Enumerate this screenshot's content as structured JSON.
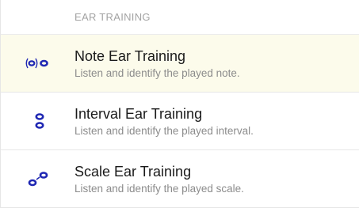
{
  "section": {
    "header": "EAR TRAINING"
  },
  "items": [
    {
      "title": "Note Ear Training",
      "subtitle": "Listen and identify the played note.",
      "icon": "note-icon",
      "selected": true
    },
    {
      "title": "Interval Ear Training",
      "subtitle": "Listen and identify the played interval.",
      "icon": "interval-icon",
      "selected": false
    },
    {
      "title": "Scale Ear Training",
      "subtitle": "Listen and identify the played scale.",
      "icon": "scale-icon",
      "selected": false
    }
  ],
  "colors": {
    "icon": "#1f27b3",
    "selected_background": "#fcfbeb",
    "title": "#1a1a1a",
    "subtitle": "#8c8c8c",
    "header": "#a3a3a3"
  }
}
